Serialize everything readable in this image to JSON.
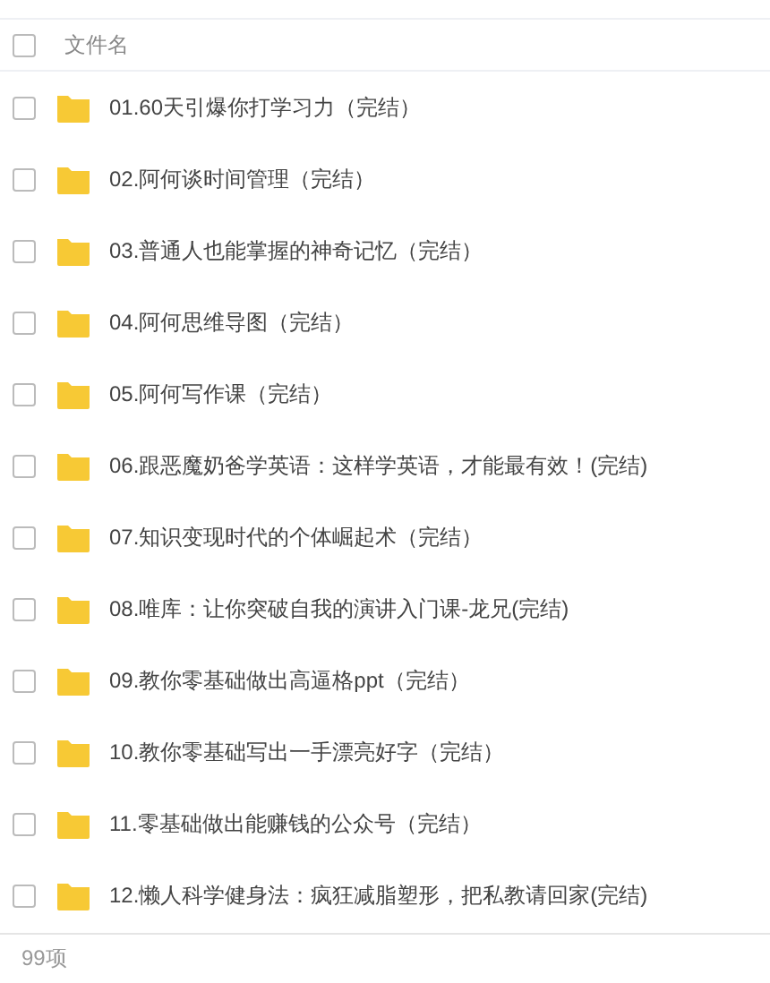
{
  "header": {
    "checked": false,
    "column_label": "文件名"
  },
  "files": [
    {
      "name": "01.60天引爆你打学习力（完结）",
      "checked": false
    },
    {
      "name": "02.阿何谈时间管理（完结）",
      "checked": false
    },
    {
      "name": "03.普通人也能掌握的神奇记忆（完结）",
      "checked": false
    },
    {
      "name": "04.阿何思维导图（完结）",
      "checked": false
    },
    {
      "name": "05.阿何写作课（完结）",
      "checked": false
    },
    {
      "name": "06.跟恶魔奶爸学英语：这样学英语，才能最有效！(完结)",
      "checked": false
    },
    {
      "name": "07.知识变现时代的个体崛起术（完结）",
      "checked": false
    },
    {
      "name": "08.唯库：让你突破自我的演讲入门课-龙兄(完结)",
      "checked": false
    },
    {
      "name": "09.教你零基础做出高逼格ppt（完结）",
      "checked": false
    },
    {
      "name": "10.教你零基础写出一手漂亮好字（完结）",
      "checked": false
    },
    {
      "name": "11.零基础做出能赚钱的公众号（完结）",
      "checked": false
    },
    {
      "name": "12.懒人科学健身法：疯狂减脂塑形，把私教请回家(完结)",
      "checked": false
    }
  ],
  "footer": {
    "count": "99项"
  }
}
